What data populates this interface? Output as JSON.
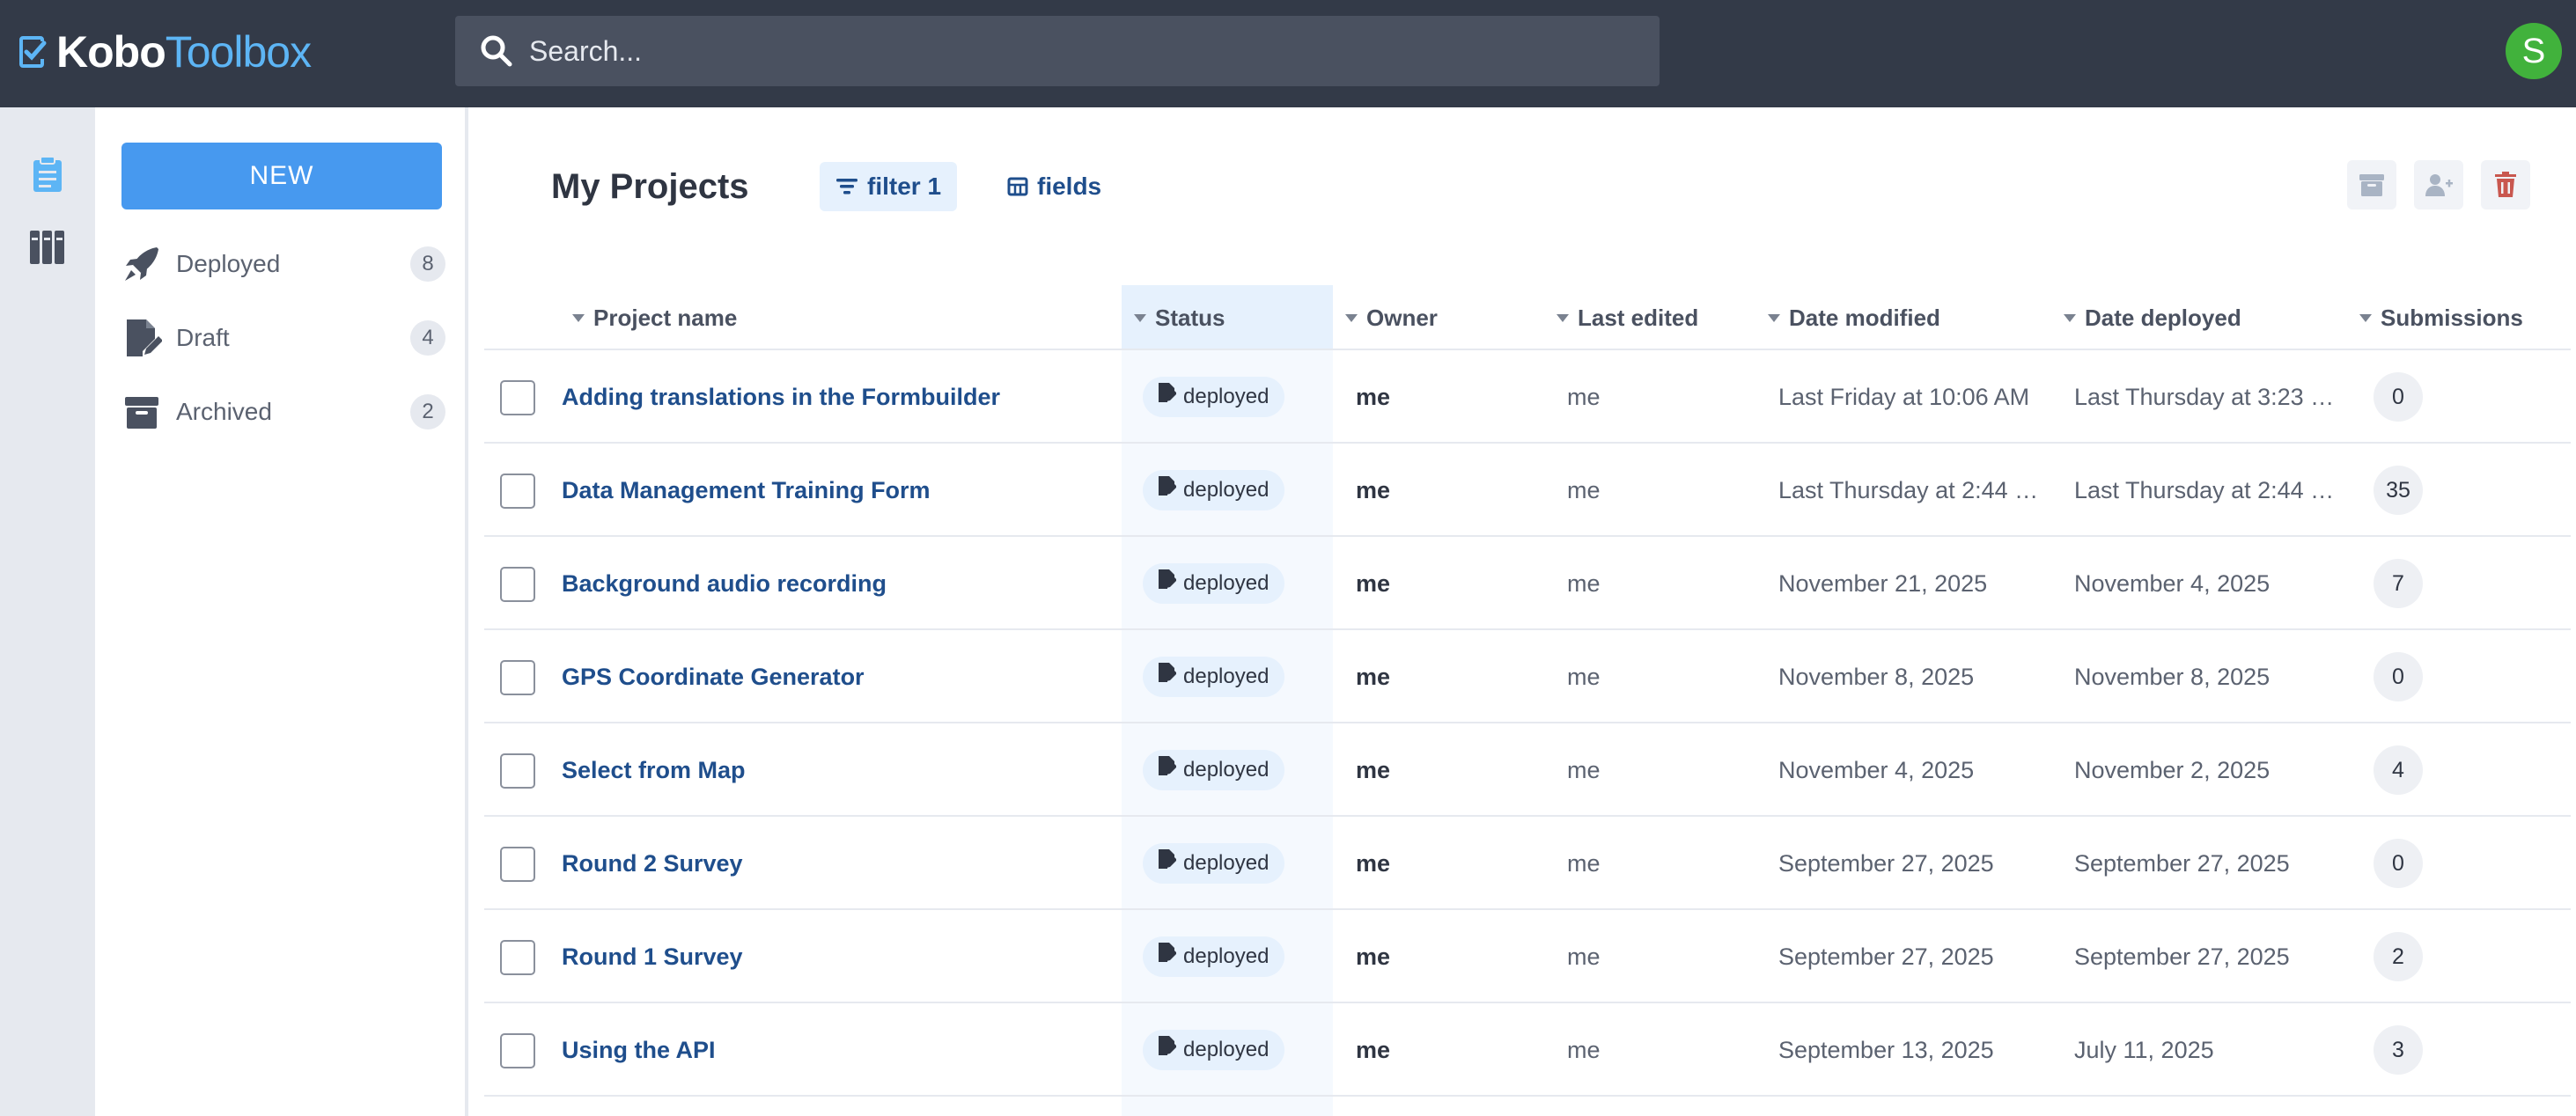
{
  "header": {
    "logo_kobo": "Kobo",
    "logo_toolbox": "Toolbox",
    "search_placeholder": "Search...",
    "avatar_initial": "S"
  },
  "sidemenu": {
    "new_label": "NEW",
    "items": [
      {
        "label": "Deployed",
        "count": "8",
        "icon": "rocket-icon"
      },
      {
        "label": "Draft",
        "count": "4",
        "icon": "draft-file-icon"
      },
      {
        "label": "Archived",
        "count": "2",
        "icon": "archive-box-icon"
      }
    ]
  },
  "main": {
    "title": "My Projects",
    "filter_label": "filter 1",
    "fields_label": "fields",
    "actions": [
      "archive-icon",
      "share-user-icon",
      "trash-icon"
    ]
  },
  "table": {
    "columns": [
      "Project name",
      "Status",
      "Owner",
      "Last edited",
      "Date modified",
      "Date deployed",
      "Submissions"
    ],
    "rows": [
      {
        "name": "Adding translations in the Formbuilder",
        "status": "deployed",
        "owner": "me",
        "last_edited": "me",
        "modified": "Last Friday at 10:06 AM",
        "deployed": "Last Thursday at 3:23 …",
        "submissions": "0"
      },
      {
        "name": "Data Management Training Form",
        "status": "deployed",
        "owner": "me",
        "last_edited": "me",
        "modified": "Last Thursday at 2:44 …",
        "deployed": "Last Thursday at 2:44 …",
        "submissions": "35"
      },
      {
        "name": "Background audio recording",
        "status": "deployed",
        "owner": "me",
        "last_edited": "me",
        "modified": "November 21, 2025",
        "deployed": "November 4, 2025",
        "submissions": "7"
      },
      {
        "name": "GPS Coordinate Generator",
        "status": "deployed",
        "owner": "me",
        "last_edited": "me",
        "modified": "November 8, 2025",
        "deployed": "November 8, 2025",
        "submissions": "0"
      },
      {
        "name": "Select from Map",
        "status": "deployed",
        "owner": "me",
        "last_edited": "me",
        "modified": "November 4, 2025",
        "deployed": "November 2, 2025",
        "submissions": "4"
      },
      {
        "name": "Round 2 Survey",
        "status": "deployed",
        "owner": "me",
        "last_edited": "me",
        "modified": "September 27, 2025",
        "deployed": "September 27, 2025",
        "submissions": "0"
      },
      {
        "name": "Round 1 Survey",
        "status": "deployed",
        "owner": "me",
        "last_edited": "me",
        "modified": "September 27, 2025",
        "deployed": "September 27, 2025",
        "submissions": "2"
      },
      {
        "name": "Using the API",
        "status": "deployed",
        "owner": "me",
        "last_edited": "me",
        "modified": "September 13, 2025",
        "deployed": "July 11, 2025",
        "submissions": "3"
      }
    ]
  },
  "colors": {
    "header_bg": "#333a48",
    "accent": "#4799ef",
    "link": "#1f4e8c",
    "avatar": "#41b23c"
  }
}
